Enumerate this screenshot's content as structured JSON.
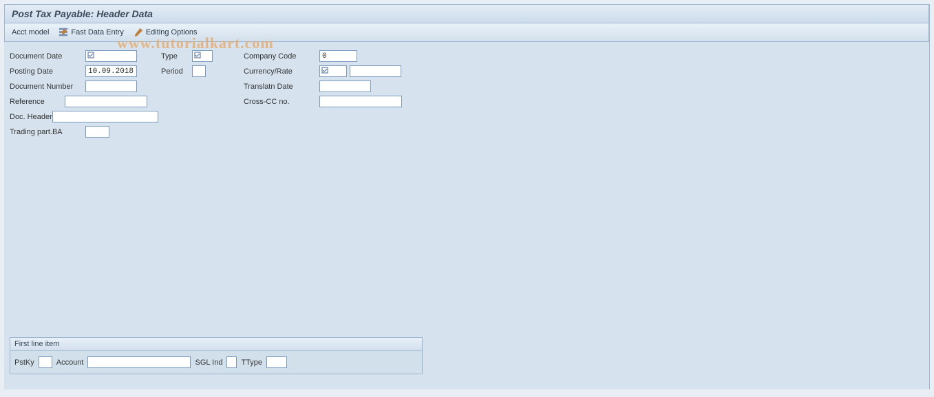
{
  "title": "Post Tax Payable: Header Data",
  "watermark": "www.tutorialkart.com",
  "toolbar": {
    "acct_model": "Acct model",
    "fast_data_entry": "Fast Data Entry",
    "editing_options": "Editing Options"
  },
  "form": {
    "col1": {
      "document_date": {
        "label": "Document Date",
        "value": ""
      },
      "posting_date": {
        "label": "Posting Date",
        "value": "10.09.2018"
      },
      "document_number": {
        "label": "Document Number",
        "value": ""
      },
      "reference": {
        "label": "Reference",
        "value": ""
      },
      "doc_header": {
        "label": "Doc. Header",
        "value": ""
      },
      "trading_part_ba": {
        "label": "Trading part.BA",
        "value": ""
      }
    },
    "col2": {
      "type": {
        "label": "Type",
        "value": ""
      },
      "period": {
        "label": "Period",
        "value": ""
      }
    },
    "col3": {
      "company_code": {
        "label": "Company Code",
        "value": "0"
      },
      "currency_rate": {
        "label": "Currency/Rate",
        "value1": "",
        "value2": ""
      },
      "translatn_date": {
        "label": "Translatn Date",
        "value": ""
      },
      "cross_cc_no": {
        "label": "Cross-CC no.",
        "value": ""
      }
    }
  },
  "line_item": {
    "title": "First line item",
    "pstky": {
      "label": "PstKy",
      "value": ""
    },
    "account": {
      "label": "Account",
      "value": ""
    },
    "sgl_ind": {
      "label": "SGL Ind",
      "value": ""
    },
    "ttype": {
      "label": "TType",
      "value": ""
    }
  }
}
